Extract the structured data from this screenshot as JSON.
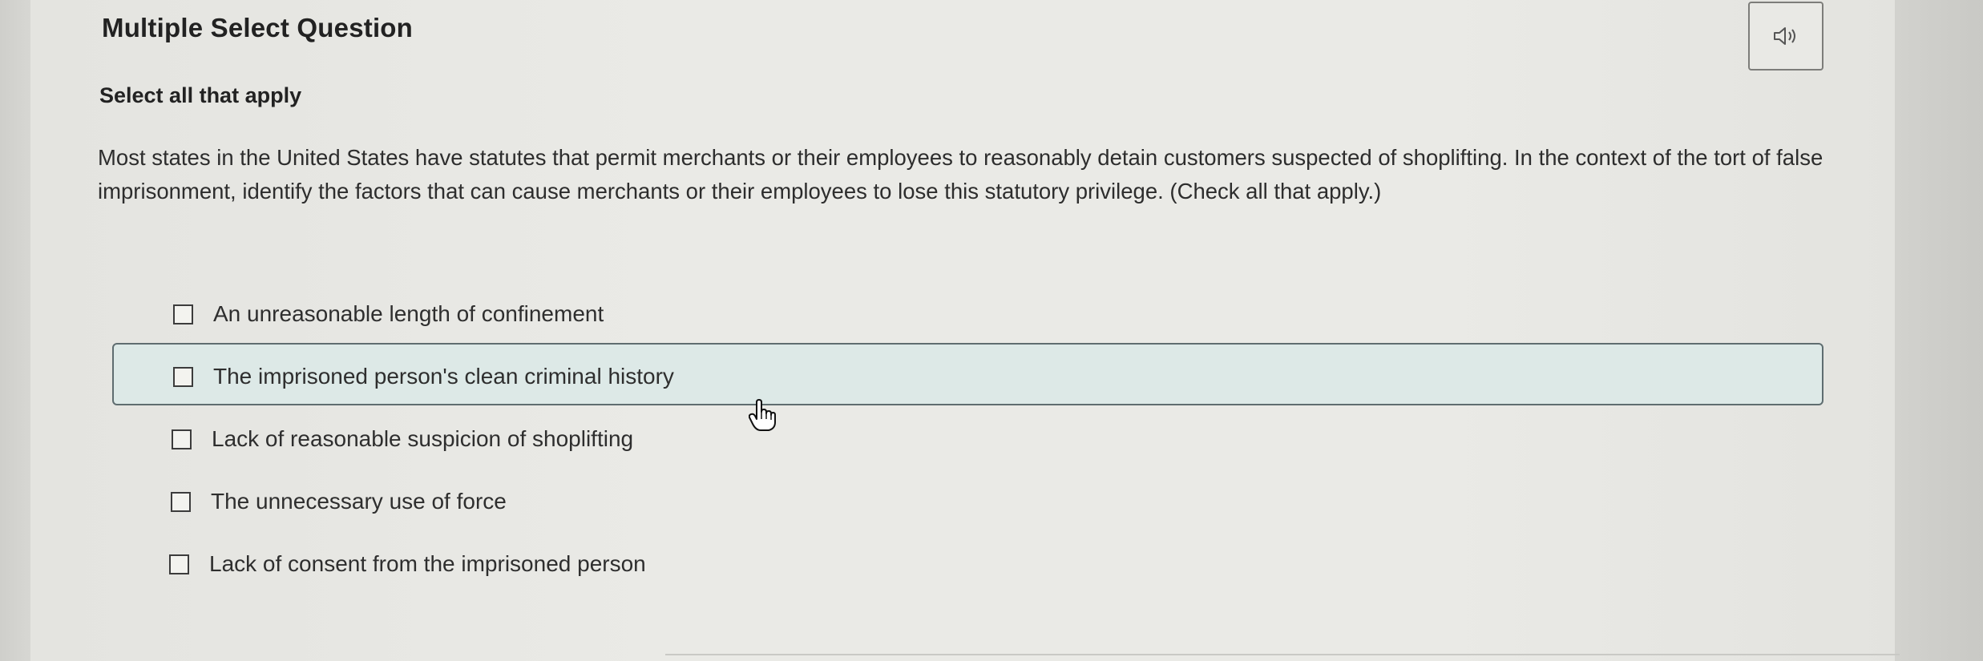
{
  "question": {
    "type_title": "Multiple Select Question",
    "instruction": "Select all that apply",
    "prompt": "Most states in the United States have statutes that permit merchants or their employees to reasonably detain customers suspected of shoplifting. In the context of the tort of false imprisonment, identify the factors that can cause merchants or their employees to lose this statutory privilege. (Check all that apply.)"
  },
  "audio_button": {
    "icon": "speaker-icon"
  },
  "options": [
    {
      "label": "An unreasonable length of confinement",
      "checked": false
    },
    {
      "label": "The imprisoned person's clean criminal history",
      "checked": false,
      "hovered": true
    },
    {
      "label": "Lack of reasonable suspicion of shoplifting",
      "checked": false
    },
    {
      "label": "The unnecessary use of force",
      "checked": false
    },
    {
      "label": "Lack of consent from the imprisoned person",
      "checked": false
    }
  ],
  "colors": {
    "hover_background": "#dde9e7",
    "hover_border": "#5f6d70",
    "page_background": "#eaeae6"
  }
}
